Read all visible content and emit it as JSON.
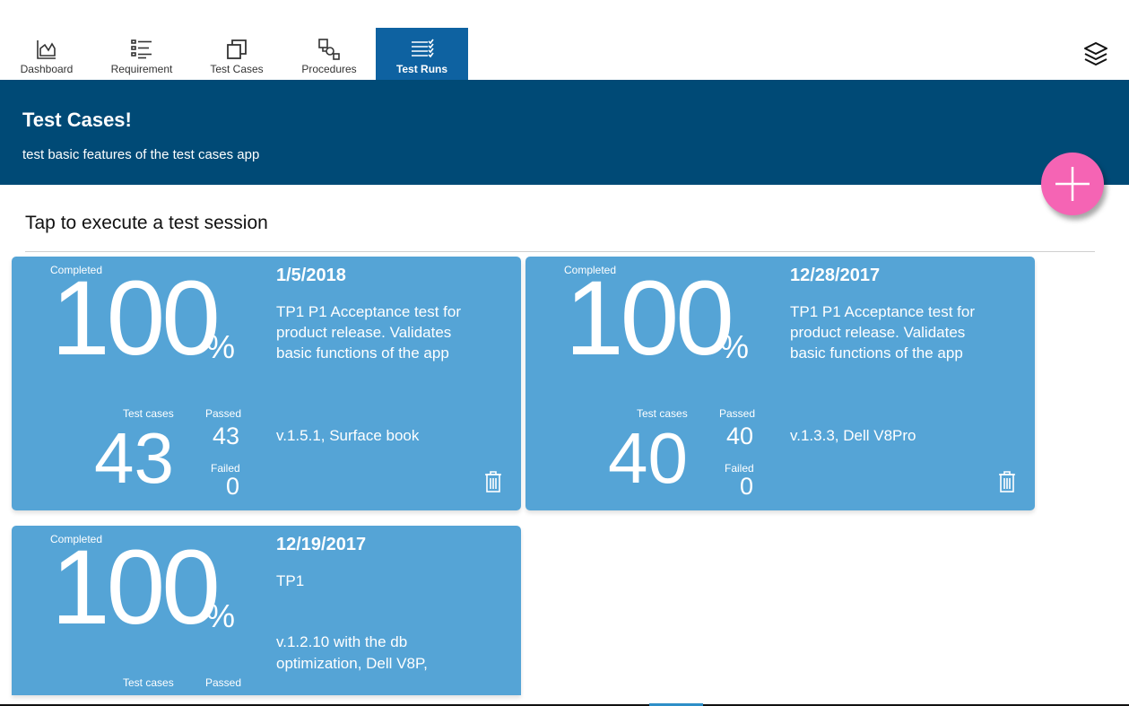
{
  "nav": {
    "tabs": [
      {
        "label": "Dashboard",
        "icon": "chart-icon"
      },
      {
        "label": "Requirement",
        "icon": "list-icon"
      },
      {
        "label": "Test Cases",
        "icon": "copy-icon"
      },
      {
        "label": "Procedures",
        "icon": "flow-icon"
      },
      {
        "label": "Test Runs",
        "icon": "checklist-icon"
      }
    ],
    "active_tab": "Test Runs",
    "layers_icon": "layers-icon"
  },
  "banner": {
    "title": "Test Cases!",
    "subtitle": "test basic features of the test cases app"
  },
  "add_button_icon": "plus-icon",
  "section_title": "Tap to execute a test session",
  "labels": {
    "completed": "Completed",
    "percent": "%",
    "test_cases": "Test cases",
    "passed": "Passed",
    "failed": "Failed"
  },
  "runs": [
    {
      "completed": "100",
      "date": "1/5/2018",
      "description": "TP1 P1 Acceptance test for product release. Validates basic functions of the app",
      "environment": "v.1.5.1, Surface book",
      "test_cases": "43",
      "passed": "43",
      "failed": "0"
    },
    {
      "completed": "100",
      "date": "12/28/2017",
      "description": "TP1 P1 Acceptance test for product release. Validates basic functions of the app",
      "environment": "v.1.3.3, Dell V8Pro",
      "test_cases": "40",
      "passed": "40",
      "failed": "0"
    },
    {
      "completed": "100",
      "date": "12/19/2017",
      "description": "TP1",
      "environment": "v.1.2.10 with the db optimization, Dell V8P,"
    }
  ],
  "colors": {
    "nav_active": "#0e62a1",
    "banner": "#004a76",
    "card": "#55a4d6",
    "fab": "#f564b4"
  }
}
